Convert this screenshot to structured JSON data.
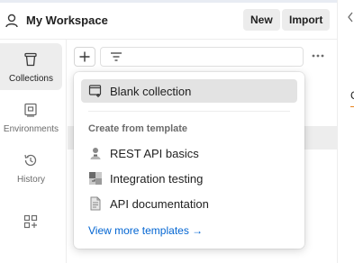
{
  "header": {
    "workspace_name": "My Workspace",
    "new_label": "New",
    "import_label": "Import",
    "icons": [
      "user-icon",
      "chevron-left-icon"
    ]
  },
  "sidebar": {
    "items": [
      {
        "label": "Collections",
        "icon": "trash-bin-icon",
        "active": true
      },
      {
        "label": "Environments",
        "icon": "environment-icon",
        "active": false
      },
      {
        "label": "History",
        "icon": "history-icon",
        "active": false
      },
      {
        "label": "",
        "icon": "add-apps-icon",
        "active": false
      }
    ]
  },
  "toolbar": {
    "add_icon": "plus-icon",
    "filter_icon": "filter-icon",
    "more_icon": "more-icon"
  },
  "dropdown": {
    "blank_collection": "Blank collection",
    "section_title": "Create from template",
    "templates": [
      {
        "label": "REST API basics",
        "icon": "rest-api-icon"
      },
      {
        "label": "Integration testing",
        "icon": "integration-icon"
      },
      {
        "label": "API documentation",
        "icon": "document-icon"
      }
    ],
    "view_more": "View more templates →"
  },
  "right_panel": {
    "partial_text": "C"
  },
  "colors": {
    "accent_orange": "#e8831b",
    "link_blue": "#0265d2",
    "active_bg": "#ededed",
    "selected_bg": "#e3e3e3"
  }
}
